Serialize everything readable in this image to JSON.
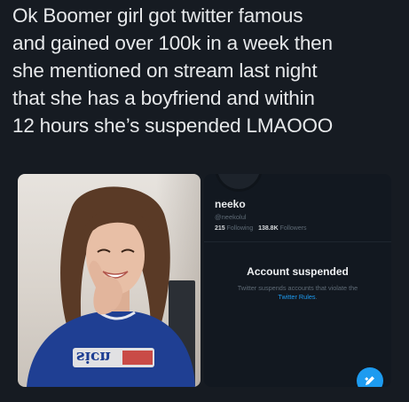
{
  "caption": {
    "lines": [
      "Ok Boomer girl got twitter famous",
      "and gained over 100k in a week then",
      "she mentioned on stream last night",
      "that she has a boyfriend and within",
      "12 hours she’s suspended LMAOOO"
    ]
  },
  "photo": {
    "shirt_text": "sicn",
    "colors": {
      "hair": "#5a3a26",
      "skin": "#e8bfa6",
      "shirt": "#1f3f93"
    }
  },
  "profile": {
    "name": "neeko",
    "handle": "@neekolul",
    "following_count": "215",
    "following_label": "Following",
    "followers_count": "138.8K",
    "followers_label": "Followers",
    "suspended_title": "Account suspended",
    "suspended_body": "Twitter suspends accounts that violate the",
    "rules_link": "Twitter Rules",
    "rules_suffix": ".",
    "compose_icon": "compose-icon",
    "accent": "#1d9bf0"
  }
}
